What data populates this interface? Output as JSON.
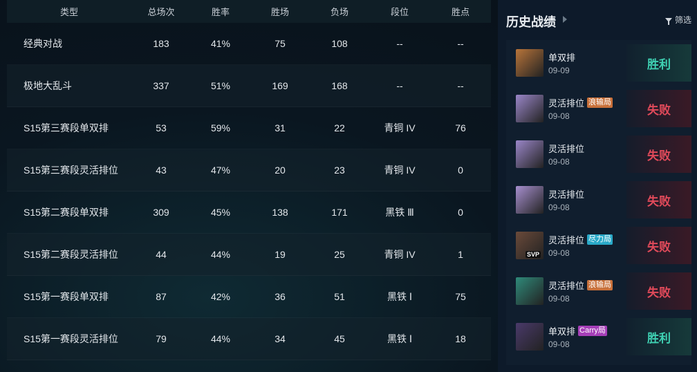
{
  "stats_table": {
    "headers": [
      "类型",
      "总场次",
      "胜率",
      "胜场",
      "负场",
      "段位",
      "胜点"
    ],
    "rows": [
      [
        "经典对战",
        "183",
        "41%",
        "75",
        "108",
        "--",
        "--"
      ],
      [
        "极地大乱斗",
        "337",
        "51%",
        "169",
        "168",
        "--",
        "--"
      ],
      [
        "S15第三赛段单双排",
        "53",
        "59%",
        "31",
        "22",
        "青铜 IV",
        "76"
      ],
      [
        "S15第三赛段灵活排位",
        "43",
        "47%",
        "20",
        "23",
        "青铜 IV",
        "0"
      ],
      [
        "S15第二赛段单双排",
        "309",
        "45%",
        "138",
        "171",
        "黑铁 Ⅲ",
        "0"
      ],
      [
        "S15第二赛段灵活排位",
        "44",
        "44%",
        "19",
        "25",
        "青铜 IV",
        "1"
      ],
      [
        "S15第一赛段单双排",
        "87",
        "42%",
        "36",
        "51",
        "黑铁 Ⅰ",
        "75"
      ],
      [
        "S15第一赛段灵活排位",
        "79",
        "44%",
        "34",
        "45",
        "黑铁 Ⅰ",
        "18"
      ]
    ]
  },
  "history": {
    "title": "历史战绩",
    "filter_label": "筛选",
    "matches": [
      {
        "mode": "单双排",
        "tag": "",
        "tag_color": "",
        "date": "09-09",
        "result": "胜利",
        "outcome": "win",
        "avatar_color": "#b8743a",
        "avatar_badge": ""
      },
      {
        "mode": "灵活排位",
        "tag": "浪输局",
        "tag_color": "#c8703a",
        "date": "09-08",
        "result": "失败",
        "outcome": "loss",
        "avatar_color": "#9a86c8",
        "avatar_badge": ""
      },
      {
        "mode": "灵活排位",
        "tag": "",
        "tag_color": "",
        "date": "09-08",
        "result": "失败",
        "outcome": "loss",
        "avatar_color": "#9a86c8",
        "avatar_badge": ""
      },
      {
        "mode": "灵活排位",
        "tag": "",
        "tag_color": "",
        "date": "09-08",
        "result": "失败",
        "outcome": "loss",
        "avatar_color": "#a78fcf",
        "avatar_badge": ""
      },
      {
        "mode": "灵活排位",
        "tag": "尽力局",
        "tag_color": "#2aa9c8",
        "date": "09-08",
        "result": "失败",
        "outcome": "loss",
        "avatar_color": "#6a4a3a",
        "avatar_badge": "SVP"
      },
      {
        "mode": "灵活排位",
        "tag": "浪输局",
        "tag_color": "#c8703a",
        "date": "09-08",
        "result": "失败",
        "outcome": "loss",
        "avatar_color": "#2f8a7a",
        "avatar_badge": ""
      },
      {
        "mode": "单双排",
        "tag": "Carry局",
        "tag_color": "#a63fb8",
        "date": "09-08",
        "result": "胜利",
        "outcome": "win",
        "avatar_color": "#4a3a6a",
        "avatar_badge": ""
      }
    ]
  }
}
